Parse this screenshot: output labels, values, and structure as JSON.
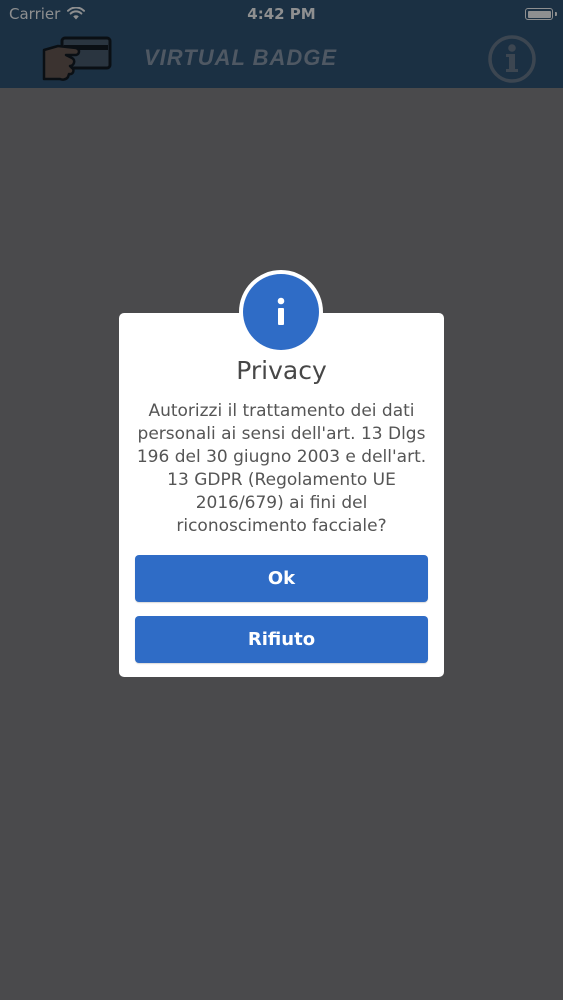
{
  "status_bar": {
    "carrier": "Carrier",
    "time": "4:42 PM",
    "battery_level": 1.0
  },
  "nav_bar": {
    "title": "VIRTUAL BADGE",
    "logo_icon": "badge-card-hand-icon",
    "info_icon": "info-circle-icon"
  },
  "dialog": {
    "icon": "info-icon",
    "title": "Privacy",
    "message": "Autorizzi il trattamento dei dati personali ai sensi dell'art. 13 Dlgs 196 del 30 giugno 2003 e dell'art. 13 GDPR (Regolamento UE 2016/679) ai fini del riconoscimento facciale?",
    "ok_label": "Ok",
    "reject_label": "Rifiuto"
  },
  "colors": {
    "overlay_background": "#4a4a4c",
    "nav_background": "#1b3043",
    "accent_blue": "#2f6cc6",
    "dialog_background": "#ffffff"
  }
}
